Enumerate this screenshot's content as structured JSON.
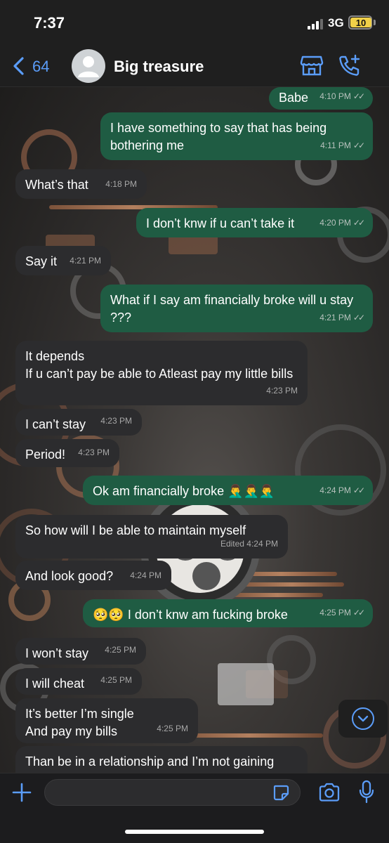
{
  "status_bar": {
    "time": "7:37",
    "network": "3G",
    "battery": "10"
  },
  "header": {
    "back_count": "64",
    "contact_name": "Big treasure",
    "accent_color": "#5b9df9"
  },
  "messages": [
    {
      "dir": "out",
      "text": "Babe",
      "time": "4:10 PM",
      "read": true
    },
    {
      "dir": "out",
      "text": "I have something to say that has being bothering me",
      "time": "4:11 PM",
      "read": true
    },
    {
      "dir": "in",
      "text": "What’s that",
      "time": "4:18 PM"
    },
    {
      "dir": "out",
      "text": "I don’t knw if u can’t take it",
      "time": "4:20 PM",
      "read": true
    },
    {
      "dir": "in",
      "text": "Say it",
      "time": "4:21 PM"
    },
    {
      "dir": "out",
      "text": "What if I say am financially broke will u stay ???",
      "time": "4:21 PM",
      "read": true
    },
    {
      "dir": "in",
      "text": "It depends\nIf u can’t pay be able to Atleast pay my little bills",
      "time": "4:23 PM"
    },
    {
      "dir": "in",
      "text": "I can’t stay",
      "time": "4:23 PM"
    },
    {
      "dir": "in",
      "text": "Period!",
      "time": "4:23 PM"
    },
    {
      "dir": "out",
      "text": "Ok am financially broke 🤦‍♂️🤦‍♂️🤦‍♂️",
      "time": "4:24 PM",
      "read": true
    },
    {
      "dir": "in",
      "text": "So how will I be able to maintain myself",
      "time": "Edited 4:24 PM"
    },
    {
      "dir": "in",
      "text": "And look good?",
      "time": "4:24 PM"
    },
    {
      "dir": "out",
      "text": "🥺🥺 I don’t knw am fucking broke",
      "time": "4:25 PM",
      "read": true
    },
    {
      "dir": "in",
      "text": "I won’t stay",
      "time": "4:25 PM"
    },
    {
      "dir": "in",
      "text": "I will cheat",
      "time": "4:25 PM"
    },
    {
      "dir": "in",
      "text": "It’s better I’m single\nAnd pay my bills",
      "time": "4:25 PM"
    },
    {
      "dir": "in",
      "text": "Than be in a relationship and I’m not gaining",
      "time": ""
    }
  ],
  "input": {
    "placeholder": ""
  },
  "icons": [
    "back-chevron-icon",
    "avatar-placeholder-icon",
    "store-icon",
    "add-call-icon",
    "chevron-down-icon",
    "plus-icon",
    "sticker-icon",
    "camera-icon",
    "microphone-icon"
  ]
}
